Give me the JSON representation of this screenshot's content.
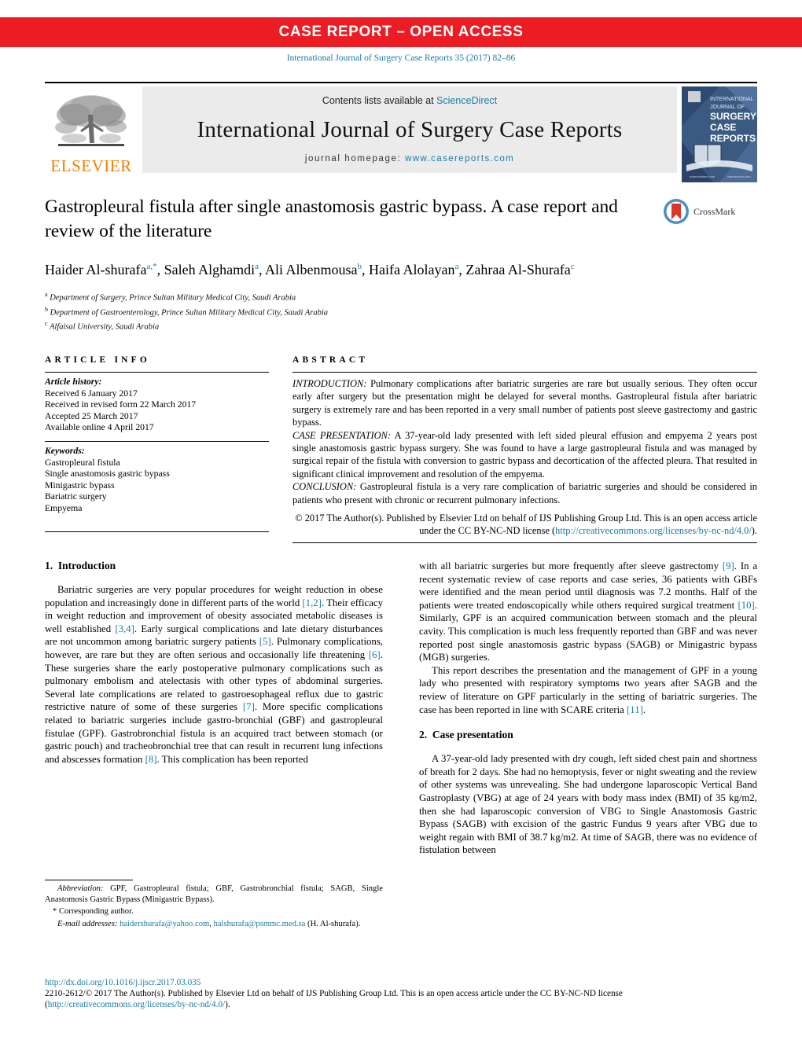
{
  "banner": {
    "label": "CASE REPORT – OPEN ACCESS",
    "color": "#ec1c24"
  },
  "citation": "International Journal of Surgery Case Reports 35 (2017) 82–86",
  "masthead": {
    "publisher_name": "ELSEVIER",
    "contents_prefix": "Contents lists available at ",
    "contents_link": "ScienceDirect",
    "journal_title": "International Journal of Surgery Case Reports",
    "homepage_prefix": "journal homepage: ",
    "homepage_url": "www.casereports.com",
    "cover_lines": [
      "INTERNATIONAL",
      "JOURNAL OF",
      "SURGERY",
      "CASE",
      "REPORTS"
    ]
  },
  "article": {
    "title": "Gastropleural fistula after single anastomosis gastric bypass. A case report and review of the literature",
    "crossmark_label": "CrossMark",
    "authors": [
      {
        "name": "Haider Al-shurafa",
        "marks": "a,*"
      },
      {
        "name": "Saleh Alghamdi",
        "marks": "a"
      },
      {
        "name": "Ali Albenmousa",
        "marks": "b"
      },
      {
        "name": "Haifa Alolayan",
        "marks": "a"
      },
      {
        "name": "Zahraa Al-Shurafa",
        "marks": "c"
      }
    ],
    "affiliations": [
      {
        "mark": "a",
        "text": "Department of Surgery, Prince Sultan Military Medical City, Saudi Arabia"
      },
      {
        "mark": "b",
        "text": "Department of Gastroenterology, Prince Sultan Military Medical City, Saudi Arabia"
      },
      {
        "mark": "c",
        "text": "Alfaisal University, Saudi Arabia"
      }
    ]
  },
  "article_info": {
    "heading": "ARTICLE INFO",
    "history_label": "Article history:",
    "history": [
      "Received 6 January 2017",
      "Received in revised form 22 March 2017",
      "Accepted 25 March 2017",
      "Available online 4 April 2017"
    ],
    "keywords_label": "Keywords:",
    "keywords": [
      "Gastropleural fistula",
      "Single anastomosis gastric bypass",
      "Minigastric bypass",
      "Bariatric surgery",
      "Empyema"
    ]
  },
  "abstract": {
    "heading": "ABSTRACT",
    "sections": [
      {
        "label": "INTRODUCTION:",
        "text": " Pulmonary complications after bariatric surgeries are rare but usually serious. They often occur early after surgery but the presentation might be delayed for several months. Gastropleural fistula after bariatric surgery is extremely rare and has been reported in a very small number of patients post sleeve gastrectomy and gastric bypass."
      },
      {
        "label": "CASE PRESENTATION:",
        "text": " A 37-year-old lady presented with left sided pleural effusion and empyema 2 years post single anastomosis gastric bypass surgery. She was found to have a large gastropleural fistula and was managed by surgical repair of the fistula with conversion to gastric bypass and decortication of the affected pleura. That resulted in significant clinical improvement and resolution of the empyema."
      },
      {
        "label": "CONCLUSION:",
        "text": " Gastropleural fistula is a very rare complication of bariatric surgeries and should be considered in patients who present with chronic or recurrent pulmonary infections."
      }
    ],
    "copyright_pre": "© 2017 The Author(s). Published by Elsevier Ltd on behalf of IJS Publishing Group Ltd. This is an open access article under the CC BY-NC-ND license (",
    "copyright_link": "http://creativecommons.org/licenses/by-nc-nd/4.0/",
    "copyright_post": ")."
  },
  "sections": {
    "introduction": {
      "number": "1.",
      "heading": "Introduction",
      "paragraph_left": "Bariatric surgeries are very popular procedures for weight reduction in obese population and increasingly done in different parts of the world [1,2]. Their efficacy in weight reduction and improvement of obesity associated metabolic diseases is well established [3,4]. Early surgical complications and late dietary disturbances are not uncommon among bariatric surgery patients [5]. Pulmonary complications, however, are rare but they are often serious and occasionally life threatening [6]. These surgeries share the early postoperative pulmonary complications such as pulmonary embolism and atelectasis with other types of abdominal surgeries. Several late complications are related to gastroesophageal reflux due to gastric restrictive nature of some of these surgeries [7]. More specific complications related to bariatric surgeries include gastro-bronchial (GBF) and gastropleural fistulae (GPF). Gastrobronchial fistula is an acquired tract between stomach (or gastric pouch) and tracheobronchial tree that can result in recurrent lung infections and abscesses formation [8]. This complication has been reported",
      "paragraph_right_cont": "with all bariatric surgeries but more frequently after sleeve gastrectomy [9]. In a recent systematic review of case reports and case series, 36 patients with GBFs were identified and the mean period until diagnosis was 7.2 months. Half of the patients were treated endoscopically while others required surgical treatment [10]. Similarly, GPF is an acquired communication between stomach and the pleural cavity. This complication is much less frequently reported than GBF and was never reported post single anastomosis gastric bypass (SAGB) or Minigastric bypass (MGB) surgeries.",
      "paragraph_right_2": "This report describes the presentation and the management of GPF in a young lady who presented with respiratory symptoms two years after SAGB and the review of literature on GPF particularly in the setting of bariatric surgeries. The case has been reported in line with SCARE criteria [11]."
    },
    "case_presentation": {
      "number": "2.",
      "heading": "Case presentation",
      "paragraph": "A 37-year-old lady presented with dry cough, left sided chest pain and shortness of breath for 2 days. She had no hemoptysis, fever or night sweating and the review of other systems was unrevealing. She had undergone laparoscopic Vertical Band Gastroplasty (VBG) at age of 24 years with body mass index (BMI) of 35 kg/m2, then she had laparoscopic conversion of VBG to Single Anastomosis Gastric Bypass (SAGB) with excision of the gastric Fundus 9 years after VBG due to weight regain with BMI of 38.7 kg/m2. At time of SAGB, there was no evidence of fistulation between"
    }
  },
  "footnotes": {
    "abbreviation_label": "Abbreviation:",
    "abbreviation_text": " GPF, Gastropleural fistula; GBF, Gastrobronchial fistula; SAGB, Single Anastomosis Gastric Bypass (Minigastric Bypass).",
    "corresponding": "* Corresponding author.",
    "email_label": "E-mail addresses:",
    "emails": [
      "haidershurafa@yahoo.com",
      "halshurafa@psmmc.med.sa"
    ],
    "email_attrib": "(H. Al-shurafa)."
  },
  "bottom": {
    "doi": "http://dx.doi.org/10.1016/j.ijscr.2017.03.035",
    "issn_copy_pre": "2210-2612/© 2017 The Author(s). Published by Elsevier Ltd on behalf of IJS Publishing Group Ltd. This is an open access article under the CC BY-NC-ND license (",
    "license_link": "http://creativecommons.org/licenses/by-nc-nd/4.0/",
    "issn_copy_post": ")."
  }
}
